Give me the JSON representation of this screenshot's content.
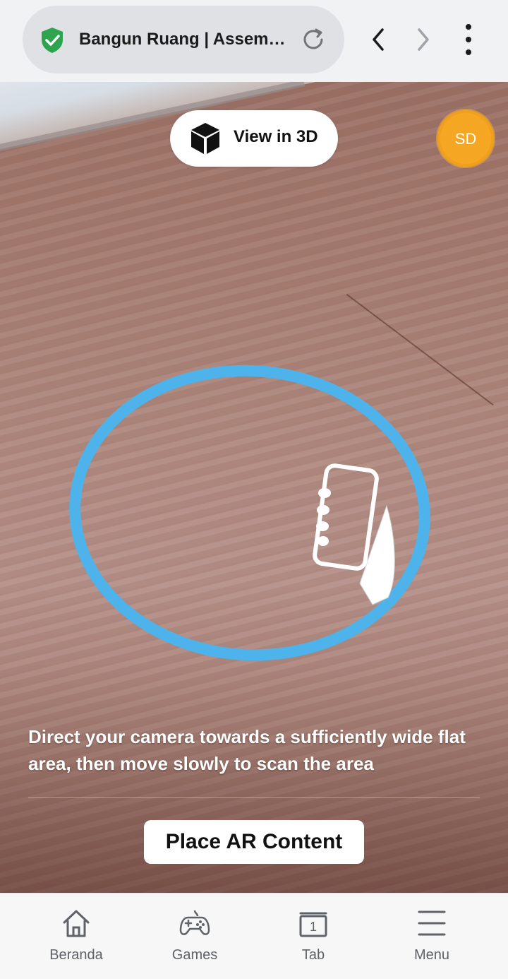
{
  "browser": {
    "url_title": "Bangun Ruang | Assemb...",
    "icons": {
      "security": "shield-check-icon",
      "reload": "reload-icon",
      "back": "chevron-left-icon",
      "forward": "chevron-right-icon",
      "menu": "more-vertical-icon"
    }
  },
  "ar": {
    "view3d_label": "View in 3D",
    "avatar_initials": "SD",
    "hint_text": "Direct your camera towards a sufficiently wide flat area, then move slowly to scan the area",
    "place_button_label": "Place AR Content",
    "colors": {
      "ring": "#4db3ea",
      "avatar": "#f5a623"
    }
  },
  "bottom_nav": {
    "items": [
      {
        "label": "Beranda",
        "icon": "home-icon"
      },
      {
        "label": "Games",
        "icon": "gamepad-icon"
      },
      {
        "label": "Tab",
        "icon": "tabs-icon",
        "count": "1"
      },
      {
        "label": "Menu",
        "icon": "hamburger-icon"
      }
    ]
  }
}
